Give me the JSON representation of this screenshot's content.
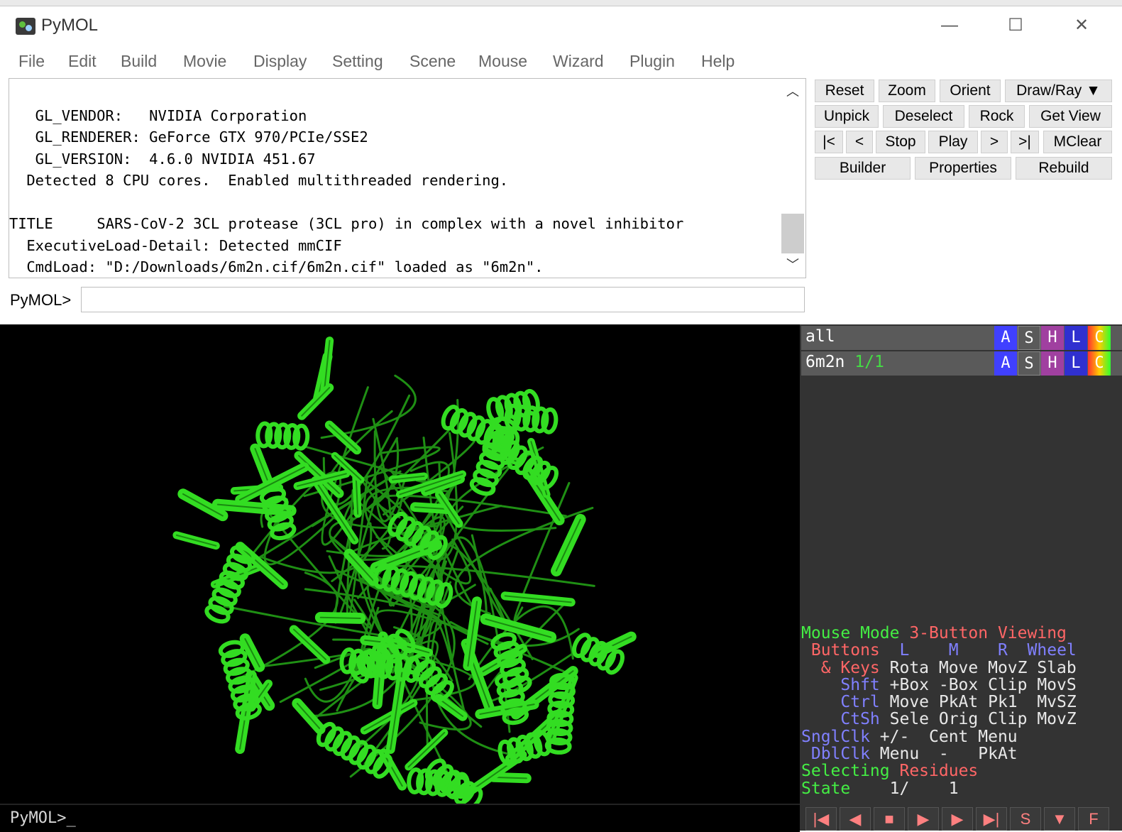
{
  "window": {
    "title": "PyMOL",
    "minimize": "—",
    "maximize": "☐",
    "close": "✕"
  },
  "menu": [
    "File",
    "Edit",
    "Build",
    "Movie",
    "Display",
    "Setting",
    "Scene",
    "Mouse",
    "Wizard",
    "Plugin",
    "Help"
  ],
  "console": {
    "lines": [
      "  GL_VENDOR:   NVIDIA Corporation",
      "  GL_RENDERER: GeForce GTX 970/PCIe/SSE2",
      "  GL_VERSION:  4.6.0 NVIDIA 451.67",
      " Detected 8 CPU cores.  Enabled multithreaded rendering.",
      "",
      "TITLE     SARS-CoV-2 3CL protease (3CL pro) in complex with a novel inhibitor",
      " ExecutiveLoad-Detail: Detected mmCIF",
      " CmdLoad: \"D:/Downloads/6m2n.cif/6m2n.cif\" loaded as \"6m2n\"."
    ]
  },
  "command": {
    "label": "PyMOL>",
    "value": ""
  },
  "buttons": {
    "row1": [
      "Reset",
      "Zoom",
      "Orient",
      "Draw/Ray ▼"
    ],
    "row2": [
      "Unpick",
      "Deselect",
      "Rock",
      "Get View"
    ],
    "row3": [
      "|<",
      "<",
      "Stop",
      "Play",
      ">",
      ">|",
      "MClear"
    ],
    "row4": [
      "Builder",
      "Properties",
      "Rebuild"
    ]
  },
  "objects": [
    {
      "name": "all",
      "state": ""
    },
    {
      "name": "6m2n",
      "state": "1/1"
    }
  ],
  "object_buttons": [
    "A",
    "S",
    "H",
    "L",
    "C"
  ],
  "object_button_colors": [
    "#4040ff",
    "#5a5a5a",
    "#a040a0",
    "#3030d0",
    "#ff4040"
  ],
  "viewer": {
    "prompt": "PyMOL>_",
    "cartoon_color": "#33dd22"
  },
  "mouse_mode": {
    "line1": [
      "Mouse Mode ",
      "3-Button Viewing"
    ],
    "line2": [
      " Buttons  ",
      "L",
      "    ",
      "M",
      "    ",
      "R",
      "  ",
      "Wheel"
    ],
    "line3": [
      "  & Keys ",
      "Rota Move MovZ Slab"
    ],
    "line4": [
      "    Shft ",
      "+Box -Box Clip MovS"
    ],
    "line5": [
      "    Ctrl ",
      "Move PkAt Pk1  MvSZ"
    ],
    "line6": [
      "    CtSh ",
      "Sele Orig Clip MovZ"
    ],
    "line7": [
      "SnglClk ",
      "+/-  Cent Menu"
    ],
    "line8": [
      " DblClk ",
      "Menu  -   PkAt"
    ],
    "line9": [
      "Selecting ",
      "Residues"
    ],
    "line10": [
      "State    ",
      "1/    1"
    ]
  },
  "playback": [
    "|◀",
    "◀",
    "■",
    "▶",
    "▶",
    "▶|",
    "S",
    "▼",
    "F"
  ]
}
